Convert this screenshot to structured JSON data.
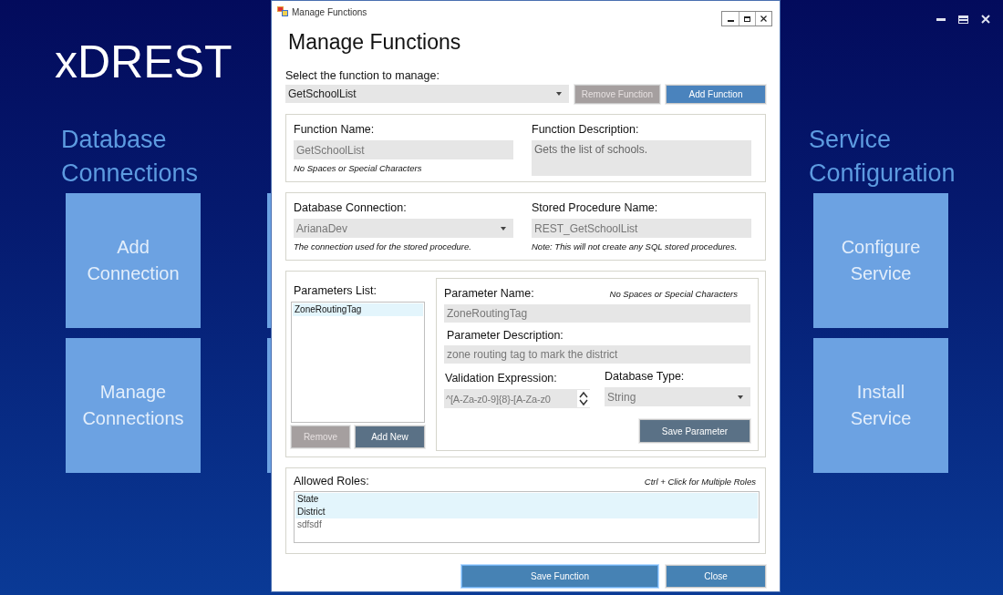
{
  "app": {
    "title": "xDREST",
    "sections": [
      {
        "heading": [
          "Database",
          "Connections"
        ],
        "tiles": [
          {
            "kind": "label",
            "lines": [
              "Add",
              "Connection"
            ]
          },
          {
            "kind": "label",
            "lines": [
              "Manage",
              "Connections"
            ]
          }
        ]
      },
      {
        "tiles": [
          {
            "kind": "covered"
          },
          {
            "kind": "covered"
          }
        ]
      },
      {
        "heading": [
          "Service",
          "Configuration"
        ],
        "tiles": [
          {
            "kind": "label",
            "lines": [
              "Configure",
              "Service"
            ]
          },
          {
            "kind": "label",
            "lines": [
              "Install",
              "Service"
            ]
          }
        ]
      }
    ]
  },
  "dialog": {
    "title": "Manage Functions",
    "heading": "Manage Functions",
    "select_label": "Select the function to manage:",
    "function_select": {
      "value": "GetSchoolList"
    },
    "top_buttons": [
      {
        "label": "Remove Function",
        "disabled": true
      },
      {
        "label": "Add Function",
        "disabled": false
      }
    ],
    "function_name": {
      "label": "Function Name:",
      "value": "GetSchoolList",
      "hint": "No Spaces or Special Characters"
    },
    "function_description": {
      "label": "Function Description:",
      "value": "Gets the list of schools."
    },
    "database_connection": {
      "label": "Database Connection:",
      "value": "ArianaDev",
      "hint": "The connection used for the stored procedure."
    },
    "stored_procedure": {
      "label": "Stored Procedure Name:",
      "value": "REST_GetSchoolList",
      "hint": "Note:  This will not create any SQL stored procedures."
    },
    "parameters": {
      "label": "Parameters List:",
      "items": [
        {
          "label": "ZoneRoutingTag",
          "selected": true
        }
      ],
      "buttons": [
        {
          "label": "Remove",
          "disabled": true
        },
        {
          "label": "Add New",
          "disabled": false
        }
      ]
    },
    "parameter": {
      "name_label": "Parameter Name:",
      "name_hint": "No Spaces or Special Characters",
      "name_value": "ZoneRoutingTag",
      "description_label": "Parameter Description:",
      "description_value": "zone routing tag to mark the district",
      "validation_label": "Validation Expression:",
      "validation_value": "^[A-Za-z0-9]{8}-[A-Za-z0",
      "type_label": "Database Type:",
      "type_value": "String",
      "save_button": "Save Parameter"
    },
    "roles": {
      "label": "Allowed Roles:",
      "hint": "Ctrl + Click for Multiple Roles",
      "items": [
        {
          "label": "State",
          "selected": true
        },
        {
          "label": "District",
          "selected": true
        },
        {
          "label": "sdfsdf",
          "selected": false
        }
      ]
    },
    "footer_buttons": [
      {
        "label": "Save Function",
        "focused": true
      },
      {
        "label": "Close",
        "focused": false
      }
    ]
  }
}
